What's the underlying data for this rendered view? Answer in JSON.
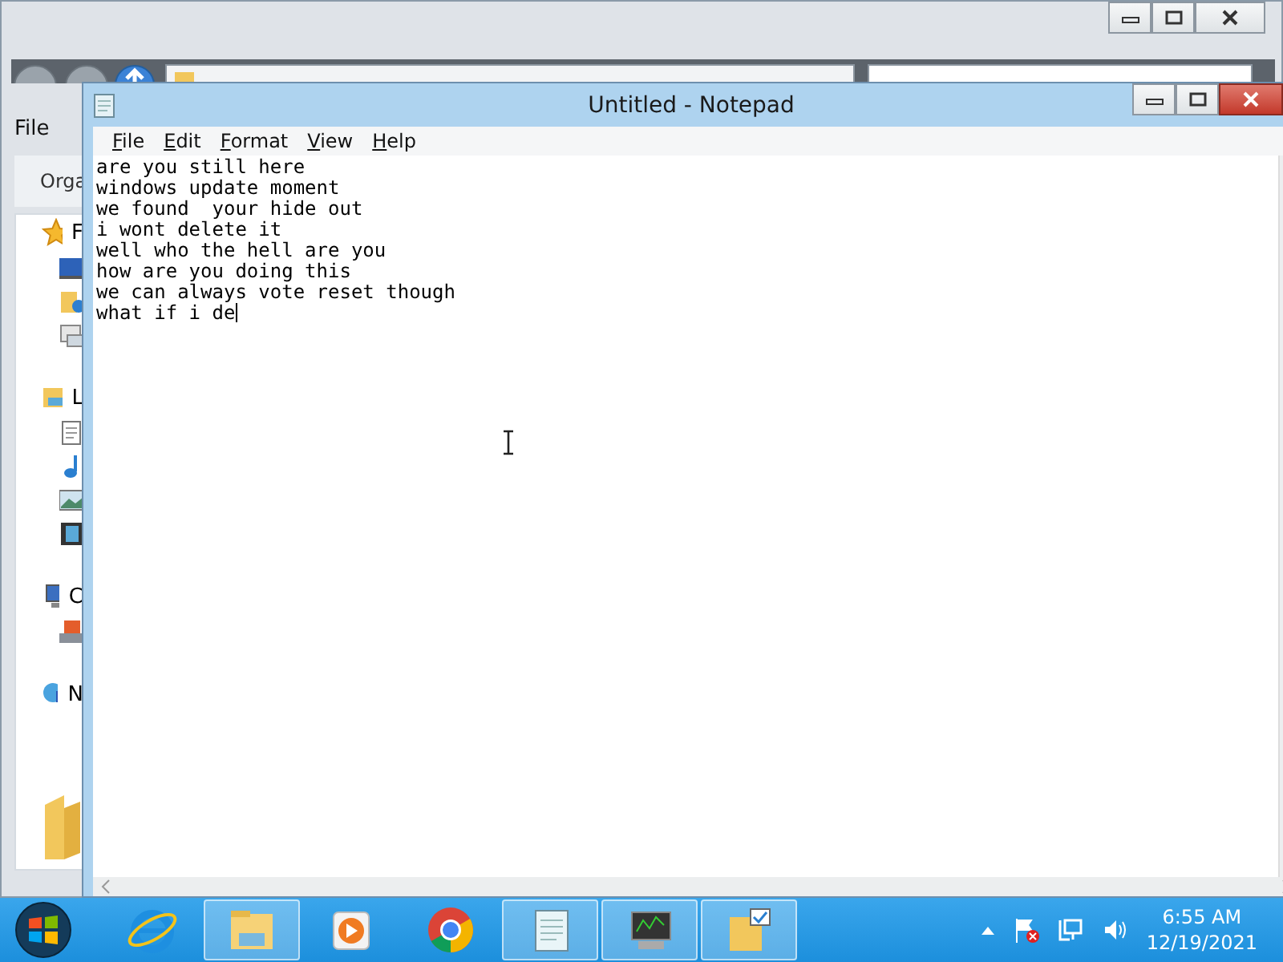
{
  "explorer": {
    "menu": [
      "File"
    ],
    "toolbar": [
      "Orga"
    ],
    "sidebar": [
      {
        "label": "F",
        "kind": "favorites",
        "children": [
          {
            "kind": "desktop"
          },
          {
            "kind": "downloads"
          },
          {
            "kind": "recent"
          }
        ]
      },
      {
        "label": "L",
        "kind": "libraries",
        "children": [
          {
            "kind": "documents"
          },
          {
            "kind": "music"
          },
          {
            "kind": "pictures"
          },
          {
            "kind": "videos"
          }
        ]
      },
      {
        "label": "C",
        "kind": "computer",
        "children": [
          {
            "kind": "drive"
          }
        ]
      },
      {
        "label": "N",
        "kind": "network"
      }
    ]
  },
  "notepad": {
    "title": "Untitled - Notepad",
    "menu": [
      "File",
      "Edit",
      "Format",
      "View",
      "Help"
    ],
    "lines": [
      "are you still here",
      "windows update moment",
      "we found  your hide out",
      "i wont delete it",
      "well who the hell are you",
      "how are you doing this",
      "we can always vote reset though",
      "what if i de"
    ]
  },
  "taskbar": {
    "apps": [
      {
        "kind": "ie",
        "running": false
      },
      {
        "kind": "explorer",
        "running": true
      },
      {
        "kind": "media",
        "running": false
      },
      {
        "kind": "chrome",
        "running": false
      },
      {
        "kind": "notepad",
        "running": true
      },
      {
        "kind": "monitor",
        "running": true
      },
      {
        "kind": "folder",
        "running": true
      }
    ],
    "time": "6:55 AM",
    "date": "12/19/2021"
  }
}
